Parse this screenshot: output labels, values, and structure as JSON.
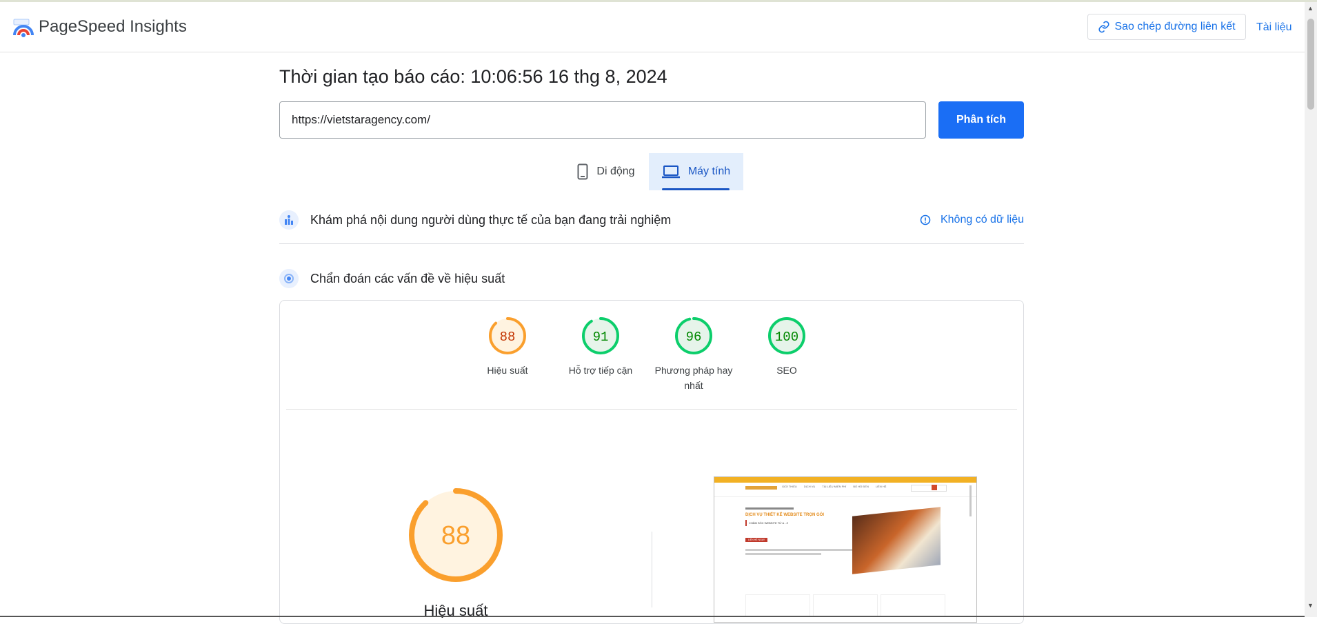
{
  "header": {
    "brand": "PageSpeed Insights",
    "copy_link_label": "Sao chép đường liên kết",
    "docs_label": "Tài liệu"
  },
  "report": {
    "time_label": "Thời gian tạo báo cáo: 10:06:56 16 thg 8, 2024",
    "url_value": "https://vietstaragency.com/",
    "analyze_label": "Phân tích"
  },
  "tabs": {
    "mobile": "Di động",
    "desktop": "Máy tính",
    "active": "desktop"
  },
  "crux": {
    "title": "Khám phá nội dung người dùng thực tế của bạn đang trải nghiệm",
    "no_data": "Không có dữ liệu"
  },
  "diagnose": {
    "title": "Chẩn đoán các vấn đề về hiệu suất"
  },
  "scores": [
    {
      "label": "Hiệu suất",
      "value": 88,
      "color": "#fa9f2d",
      "text_color": "#c33300",
      "fill": "#fff3e0"
    },
    {
      "label": "Hỗ trợ tiếp cận",
      "value": 91,
      "color": "#0cce6b",
      "text_color": "#008800",
      "fill": "#e6f4ea"
    },
    {
      "label": "Phương pháp hay nhất",
      "value": 96,
      "color": "#0cce6b",
      "text_color": "#008800",
      "fill": "#e6f4ea"
    },
    {
      "label": "SEO",
      "value": 100,
      "color": "#0cce6b",
      "text_color": "#008800",
      "fill": "#e6f4ea"
    }
  ],
  "performance": {
    "value": 88,
    "label": "Hiệu suất"
  },
  "screenshot": {
    "menu": [
      "GIỚI THIỆU",
      "DỊCH VỤ",
      "TÀI LIỆU MIỄN PHÍ",
      "BỐ HỒ ĐẾN",
      "LIÊN HỆ"
    ],
    "headline": "DỊCH VỤ THIẾT KẾ WEBSITE TRỌN GÓI",
    "subheadline": "CHĂM SÓC WEBSITE TỪ A - Z",
    "cta": "LIÊN HỆ NGAY"
  }
}
